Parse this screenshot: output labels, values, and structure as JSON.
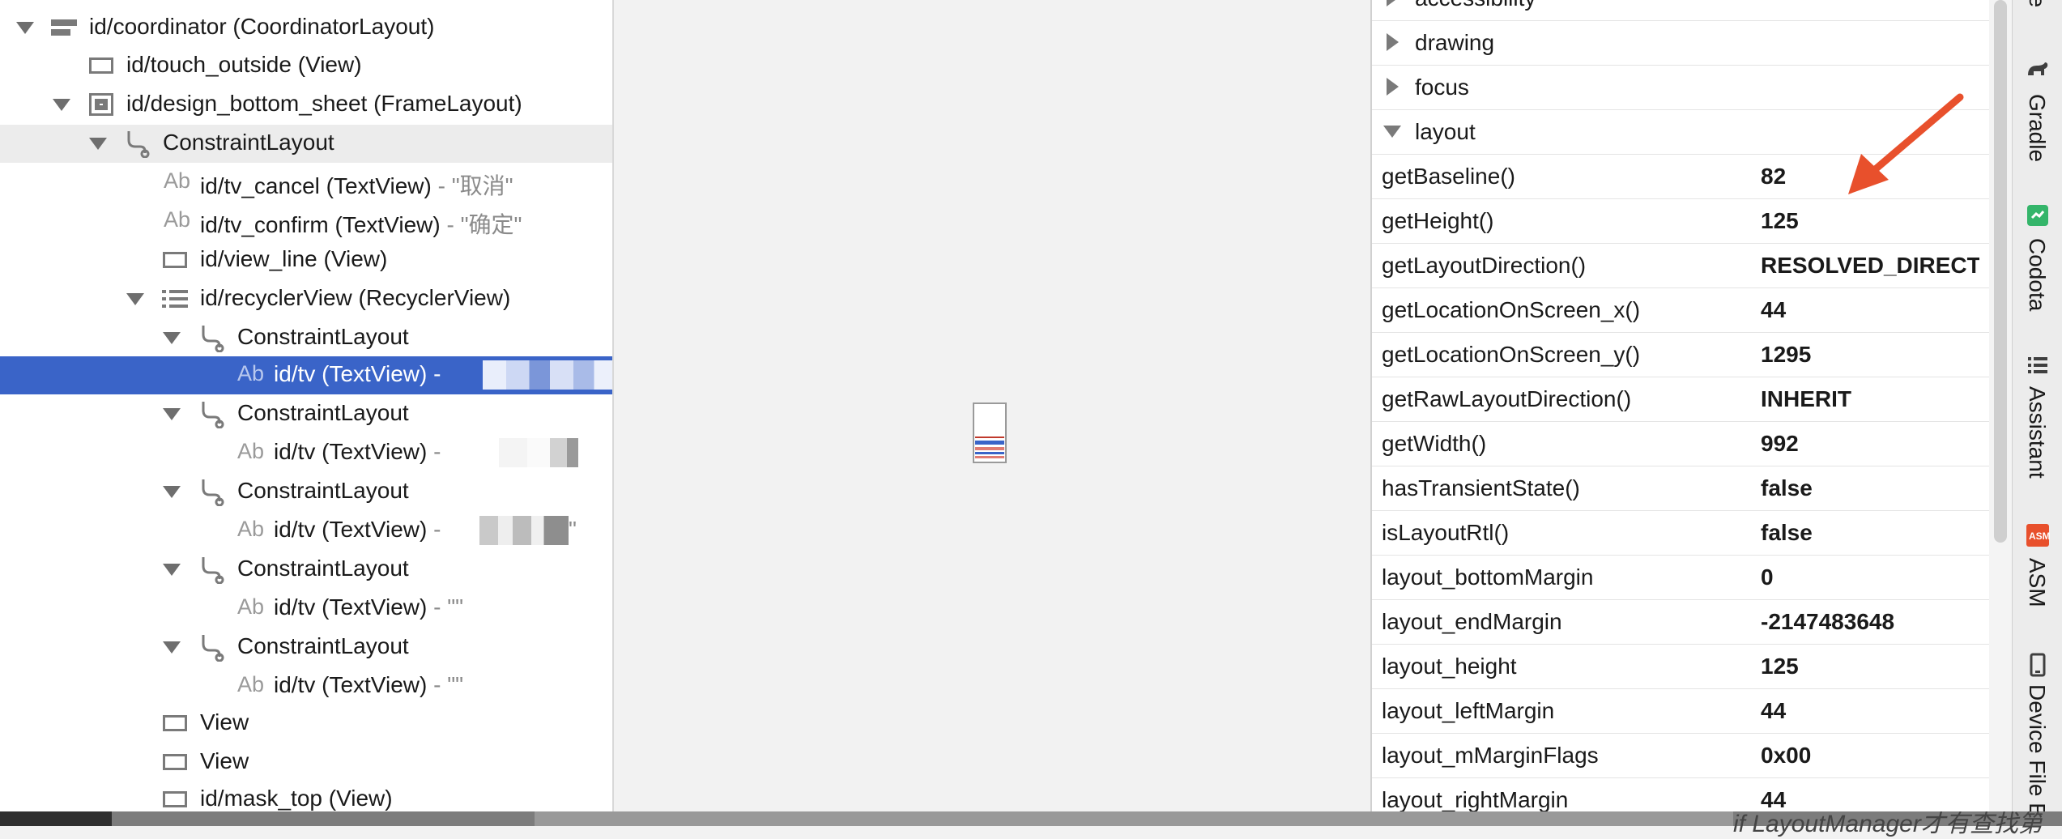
{
  "tree": {
    "rows": [
      {
        "label": "id/coordinator (CoordinatorLayout)",
        "value": ""
      },
      {
        "label": "id/touch_outside (View)",
        "value": ""
      },
      {
        "label": "id/design_bottom_sheet (FrameLayout)",
        "value": ""
      },
      {
        "label": "ConstraintLayout",
        "value": ""
      },
      {
        "label": "id/tv_cancel (TextView)",
        "value": " - \"取消\""
      },
      {
        "label": "id/tv_confirm (TextView)",
        "value": " - \"确定\""
      },
      {
        "label": "id/view_line (View)",
        "value": ""
      },
      {
        "label": "id/recyclerView (RecyclerView)",
        "value": ""
      },
      {
        "label": "ConstraintLayout",
        "value": ""
      },
      {
        "label": "id/tv (TextView)",
        "value": " - "
      },
      {
        "label": "ConstraintLayout",
        "value": ""
      },
      {
        "label": "id/tv (TextView)",
        "value": " - "
      },
      {
        "label": "ConstraintLayout",
        "value": ""
      },
      {
        "label": "id/tv (TextView)",
        "value": " - "
      },
      {
        "label": "ConstraintLayout",
        "value": ""
      },
      {
        "label": "id/tv (TextView)",
        "value": " - \"\""
      },
      {
        "label": "ConstraintLayout",
        "value": ""
      },
      {
        "label": "id/tv (TextView)",
        "value": " - \"\""
      },
      {
        "label": "View",
        "value": ""
      },
      {
        "label": "View",
        "value": ""
      },
      {
        "label": "id/mask_top (View)",
        "value": ""
      }
    ],
    "text_icon_label": "Ab",
    "row_13_trailing_quote": "\""
  },
  "props": {
    "partial_section": "accessibility",
    "sections": [
      {
        "label": "drawing",
        "expanded": false
      },
      {
        "label": "focus",
        "expanded": false
      },
      {
        "label": "layout",
        "expanded": true
      }
    ],
    "rows": [
      {
        "name": "getBaseline()",
        "value": "82"
      },
      {
        "name": "getHeight()",
        "value": "125"
      },
      {
        "name": "getLayoutDirection()",
        "value": "RESOLVED_DIRECTION"
      },
      {
        "name": "getLocationOnScreen_x()",
        "value": "44"
      },
      {
        "name": "getLocationOnScreen_y()",
        "value": "1295"
      },
      {
        "name": "getRawLayoutDirection()",
        "value": "INHERIT"
      },
      {
        "name": "getWidth()",
        "value": "992"
      },
      {
        "name": "hasTransientState()",
        "value": "false"
      },
      {
        "name": "isLayoutRtl()",
        "value": "false"
      },
      {
        "name": "layout_bottomMargin",
        "value": "0"
      },
      {
        "name": "layout_endMargin",
        "value": "-2147483648"
      },
      {
        "name": "layout_height",
        "value": "125"
      },
      {
        "name": "layout_leftMargin",
        "value": "44"
      },
      {
        "name": "layout_mMarginFlags",
        "value": "0x00"
      },
      {
        "name": "layout_rightMargin",
        "value": "44"
      }
    ]
  },
  "tool_strip": {
    "partial_top": "ne",
    "tabs": [
      {
        "label": "Gradle",
        "icon": "gradle-elephant-icon"
      },
      {
        "label": "Codota",
        "icon": "codota-icon"
      },
      {
        "label": "Assistant",
        "icon": "assistant-list-icon"
      },
      {
        "label": "ASM",
        "icon": "asm-icon"
      },
      {
        "label": "Device File E",
        "icon": "device-icon"
      }
    ]
  },
  "bottom_text": "if LayoutManager才有查找第",
  "colors": {
    "selection": "#3a64c8",
    "highlight_row": "#ececec",
    "arrow": "#e8502c"
  }
}
